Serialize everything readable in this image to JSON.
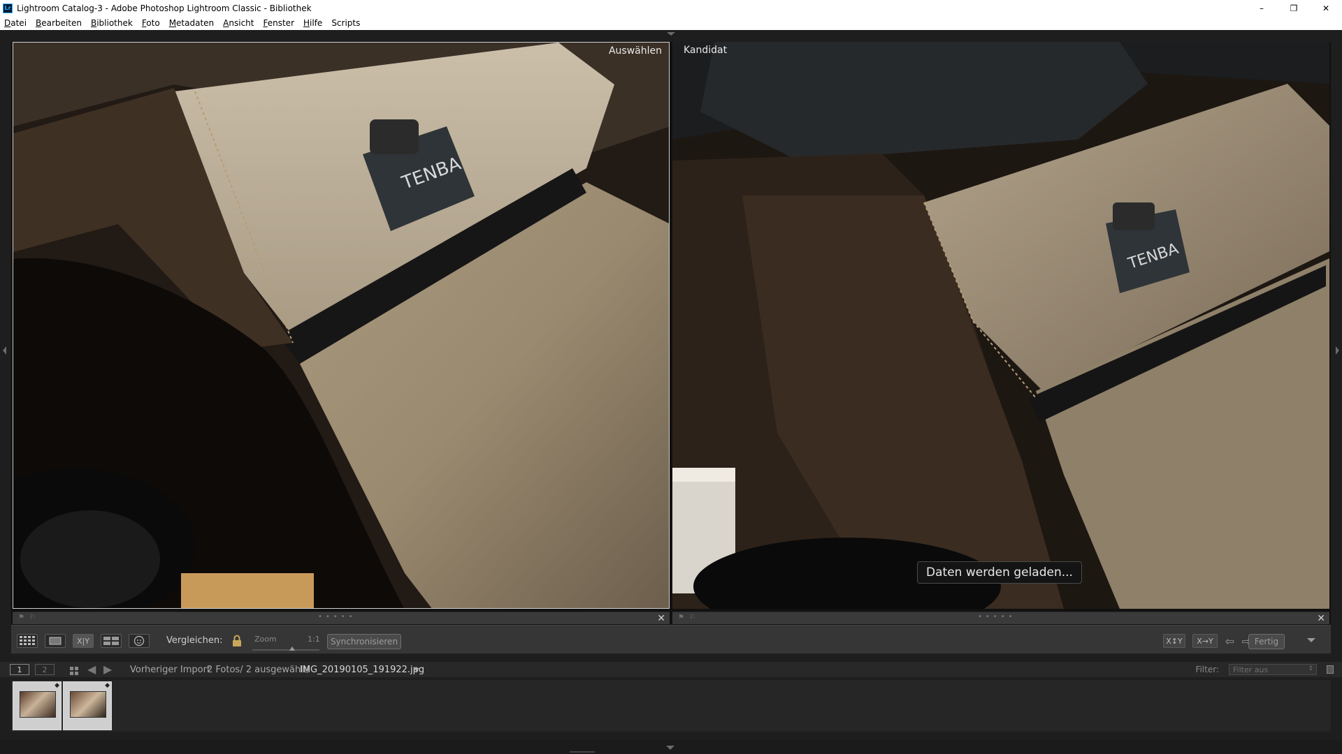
{
  "window": {
    "title": "Lightroom Catalog-3 - Adobe Photoshop Lightroom Classic - Bibliothek",
    "app_icon": "Lr",
    "minimize": "–",
    "restore": "❐",
    "close": "✕"
  },
  "menu": {
    "items": [
      {
        "label": "Datei",
        "u": "D",
        "rest": "atei"
      },
      {
        "label": "Bearbeiten",
        "u": "B",
        "rest": "earbeiten"
      },
      {
        "label": "Bibliothek",
        "u": "B",
        "rest": "ibliothek"
      },
      {
        "label": "Foto",
        "u": "F",
        "rest": "oto"
      },
      {
        "label": "Metadaten",
        "u": "M",
        "rest": "etadaten"
      },
      {
        "label": "Ansicht",
        "u": "A",
        "rest": "nsicht"
      },
      {
        "label": "Fenster",
        "u": "F",
        "rest": "enster"
      },
      {
        "label": "Hilfe",
        "u": "H",
        "rest": "ilfe"
      },
      {
        "label": "Scripts",
        "u": "",
        "rest": "Scripts"
      }
    ]
  },
  "compare": {
    "select_label": "Auswählen",
    "candidate_label": "Kandidat",
    "loading_text": "Daten werden geladen..."
  },
  "toolbar": {
    "grid_icon": "grid-view-icon",
    "loupe_icon": "loupe-view-icon",
    "compare_icon_text": "X|Y",
    "survey_icon": "survey-view-icon",
    "people_icon": "people-view-icon",
    "compare_label": "Vergleichen:",
    "zoom_label": "Zoom",
    "zoom_value": "1:1",
    "zoom_level": 0.55,
    "sync_label": "Synchronisieren",
    "swap_text": "X↕Y",
    "make_select_text": "X→Y",
    "done_label": "Fertig"
  },
  "filmbar": {
    "monitor1": "1",
    "monitor2": "2",
    "source_label": "Vorheriger Import",
    "count_text": "2 Fotos/ 2 ausgewählt/",
    "filename": "IMG_20190105_191922.jpg",
    "filter_label": "Filter:",
    "filter_value": "Filter aus"
  },
  "filmstrip": {
    "thumbs": [
      {
        "badge": "◆"
      },
      {
        "badge": "◆"
      }
    ]
  },
  "colors": {
    "panel_bg": "#1e1e1e",
    "toolbar_bg": "#363636",
    "fabric_light": "#b9ab94",
    "fabric_dark": "#3b2f25"
  }
}
